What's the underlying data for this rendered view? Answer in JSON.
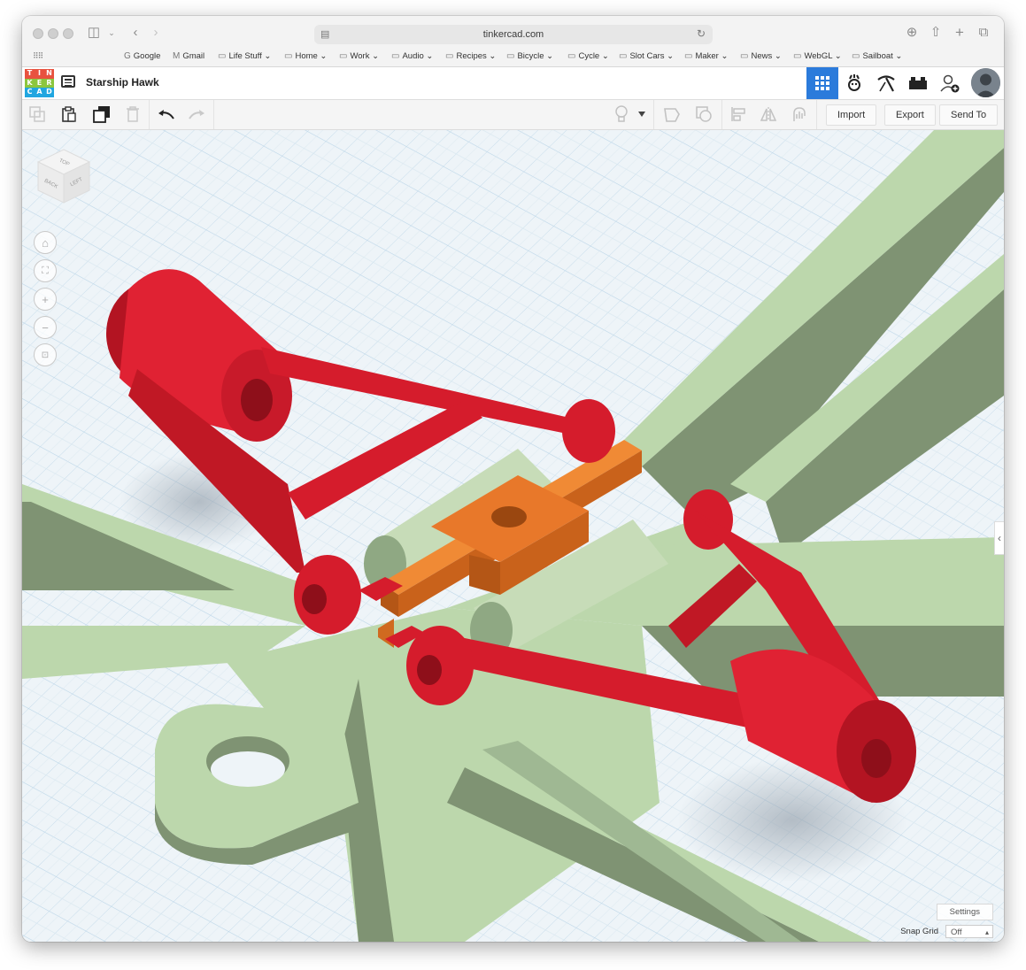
{
  "browser": {
    "url": "tinkercad.com",
    "bookmarks": [
      "Google",
      "Gmail",
      "Life Stuff",
      "Home",
      "Work",
      "Audio",
      "Recipes",
      "Bicycle",
      "Cycle",
      "Slot Cars",
      "Maker",
      "News",
      "WebGL",
      "Sailboat"
    ]
  },
  "app": {
    "logo_letters": [
      "T",
      "I",
      "N",
      "K",
      "E",
      "R",
      "C",
      "A",
      "D"
    ],
    "logo_colors": [
      "#e8523f",
      "#e8523f",
      "#e8523f",
      "#21a6e0",
      "#21a6e0",
      "#21a6e0",
      "#21a6e0",
      "#21a6e0",
      "#21a6e0"
    ],
    "title": "Starship Hawk",
    "accent": "#2b7bdb"
  },
  "toolbar": {
    "import_label": "Import",
    "export_label": "Export",
    "send_to_label": "Send To"
  },
  "viewcube": {
    "top": "TOP",
    "back": "BACK",
    "left": "LEFT"
  },
  "bottom": {
    "settings_label": "Settings",
    "snap_grid_label": "Snap Grid",
    "snap_grid_value": "Off"
  },
  "scene_colors": {
    "arms": "#dc1f30",
    "mount": "#e57a25",
    "chassis": "#bfd9b0",
    "grid": "#eaf1f6"
  }
}
